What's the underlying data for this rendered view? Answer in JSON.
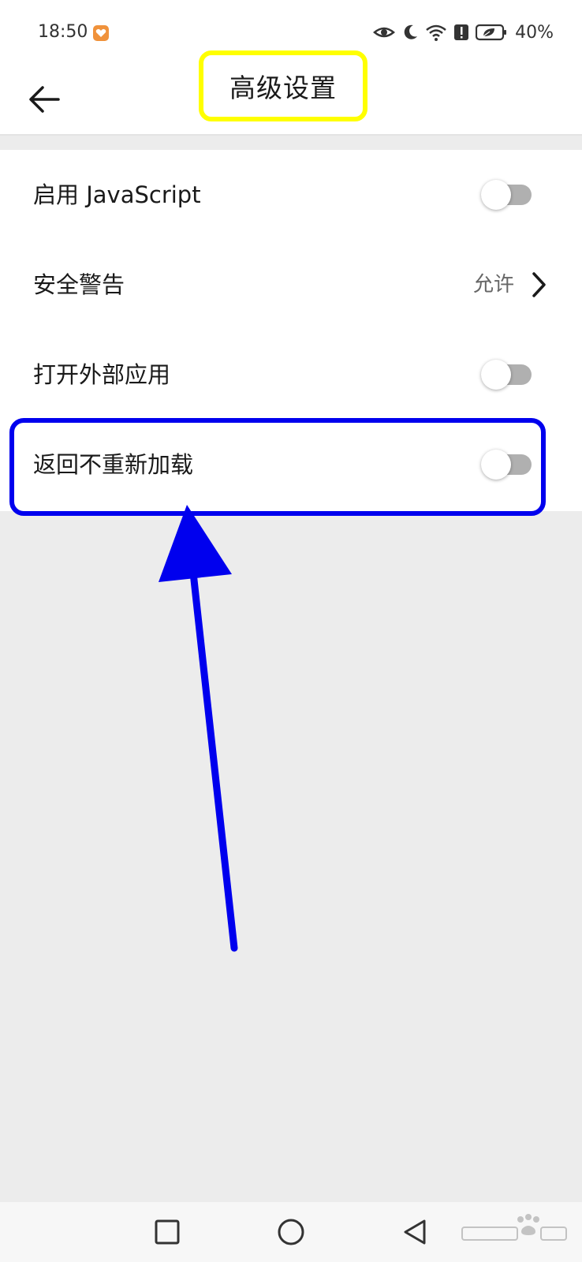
{
  "status_bar": {
    "time": "18:50",
    "battery_percent": "40%",
    "icons": [
      "eye-icon",
      "moon-icon",
      "wifi-icon",
      "alert-icon",
      "battery-icon"
    ]
  },
  "app_bar": {
    "title": "高级设置",
    "back_icon": "back-arrow-icon"
  },
  "settings": {
    "items": [
      {
        "label": "启用 JavaScript",
        "type": "toggle",
        "enabled": false
      },
      {
        "label": "安全警告",
        "type": "link",
        "value": "允许"
      },
      {
        "label": "打开外部应用",
        "type": "toggle",
        "enabled": false
      },
      {
        "label": "返回不重新加载",
        "type": "toggle",
        "enabled": false
      }
    ]
  },
  "annotations": {
    "title_highlight_color": "#ffff00",
    "row_highlight_color": "#0000ee",
    "arrow_color": "#0000ee"
  },
  "nav_bar": {
    "icons": [
      "recents-square-icon",
      "home-circle-icon",
      "back-triangle-icon"
    ]
  },
  "colors": {
    "background": "#ececec",
    "surface": "#ffffff",
    "toggle_off_track": "#b0b0b0"
  }
}
